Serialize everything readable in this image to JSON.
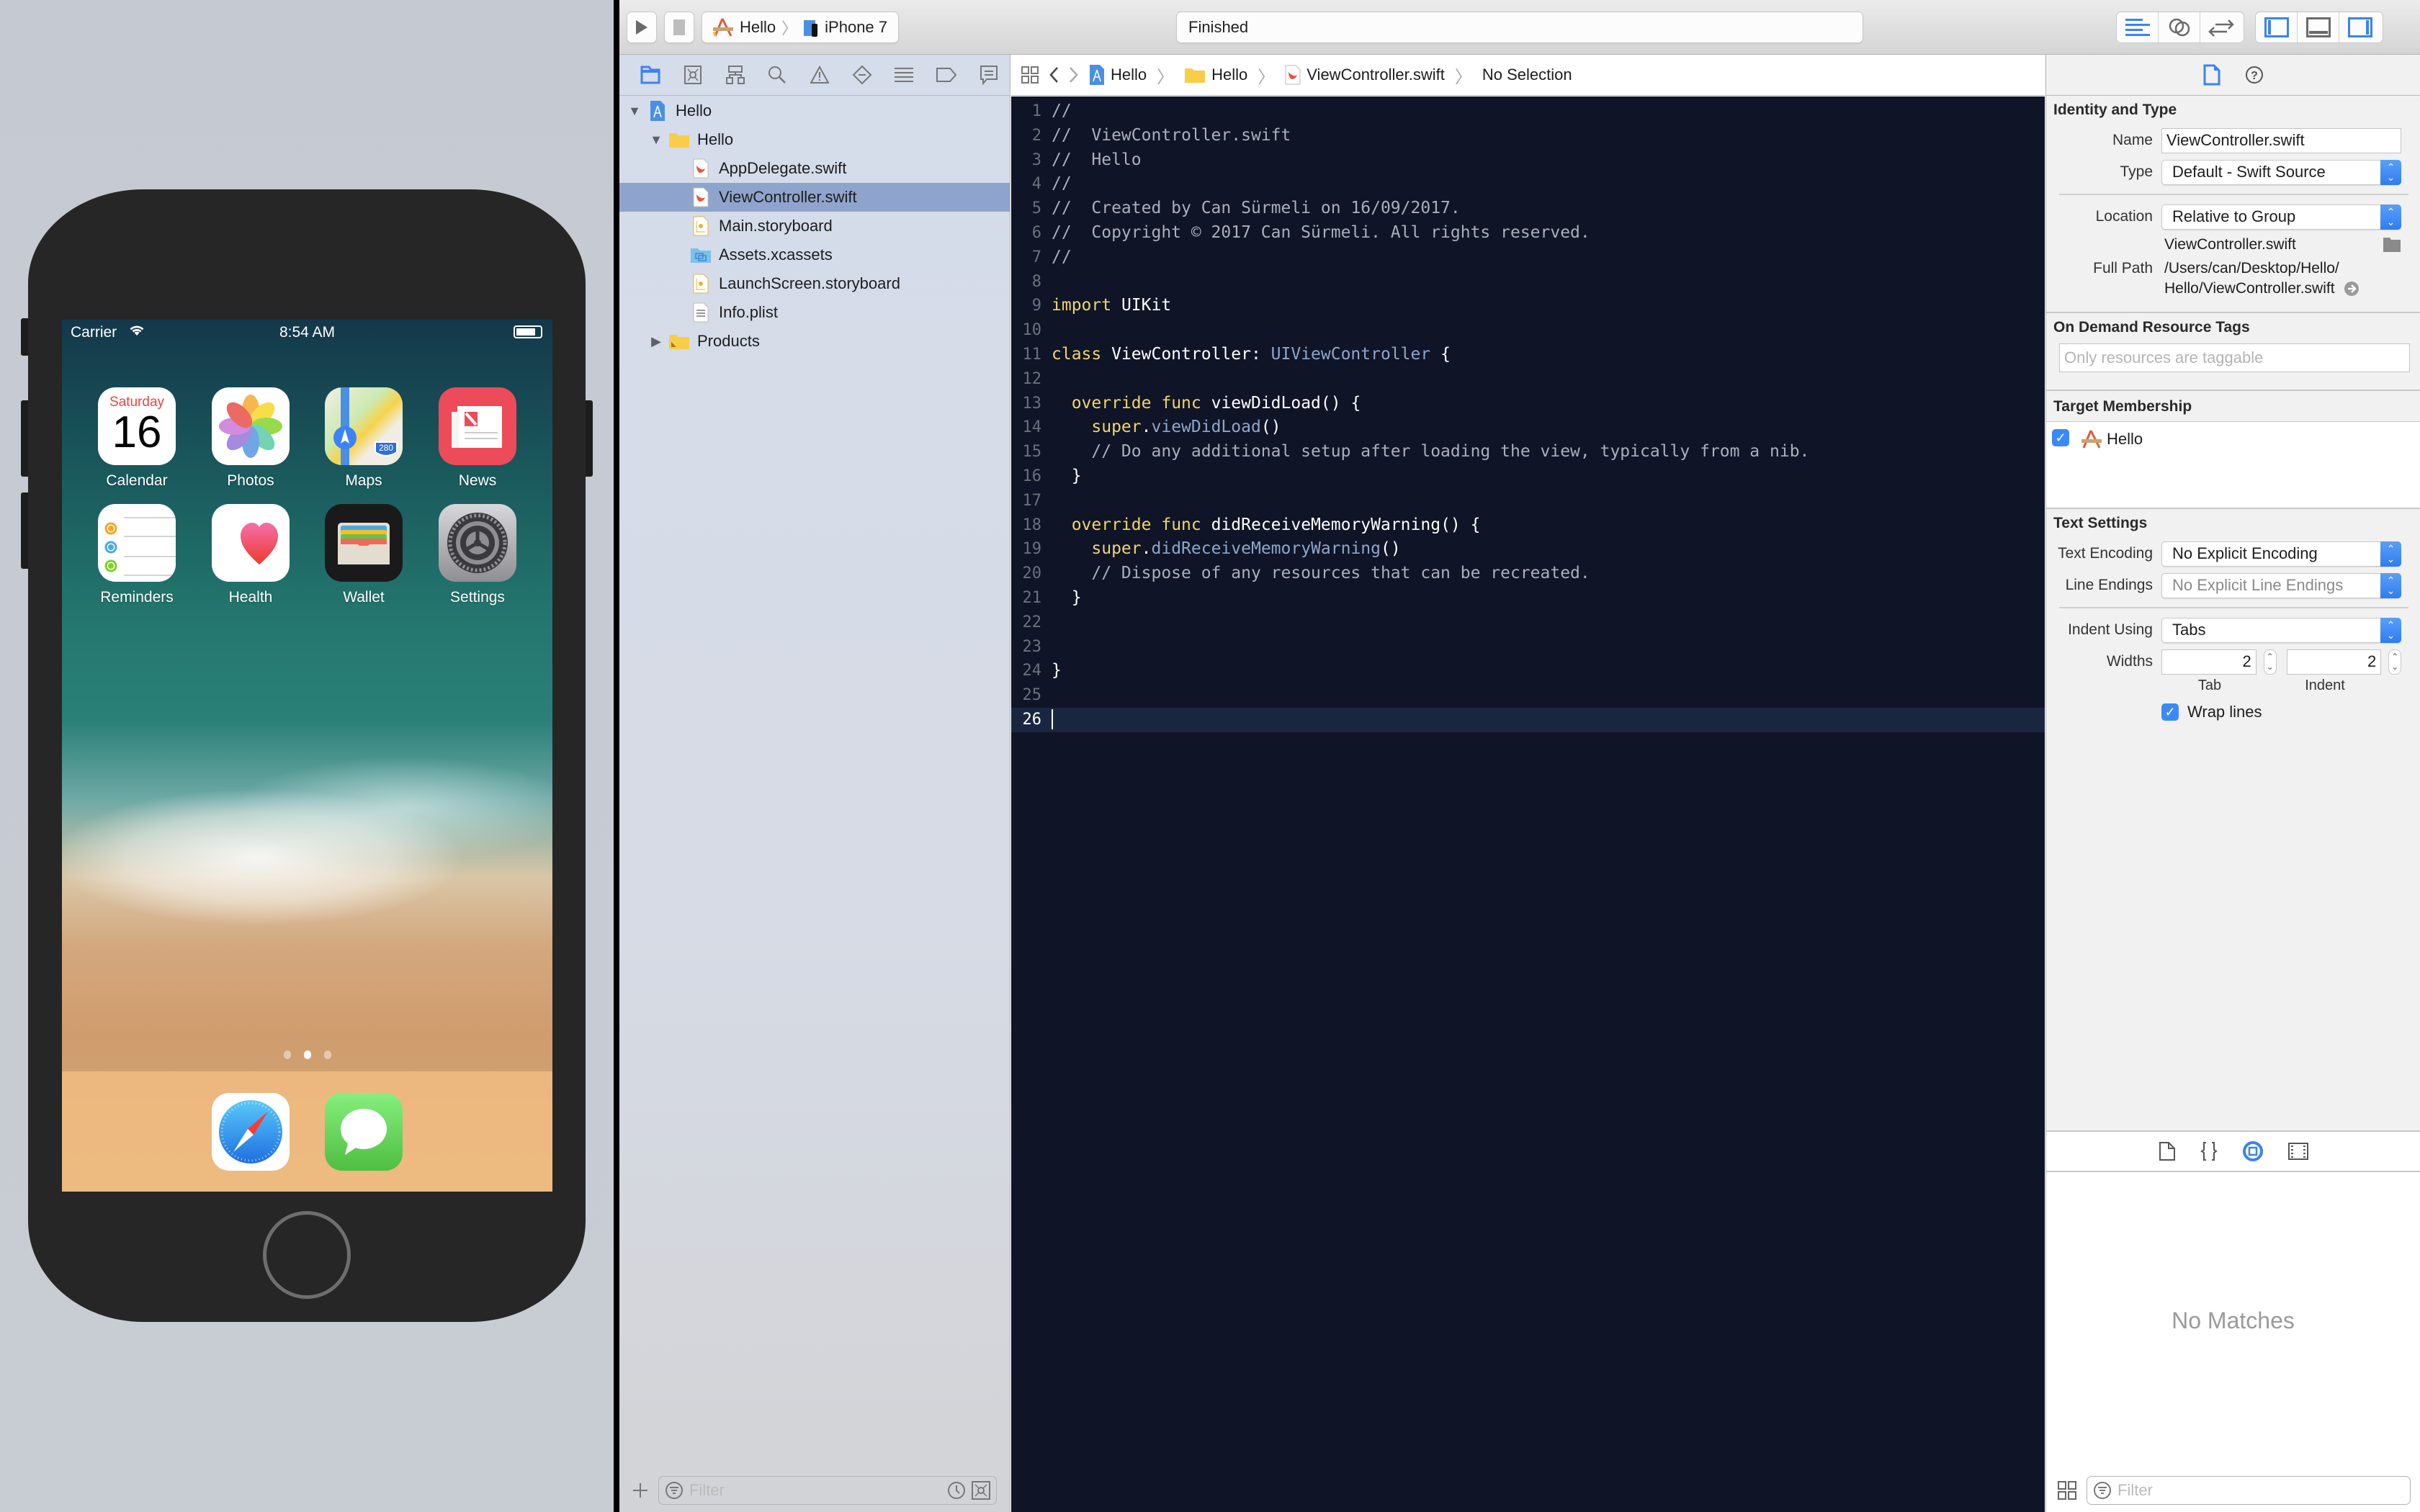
{
  "simulator": {
    "status_bar": {
      "carrier": "Carrier",
      "wifi_icon": "wifi-icon",
      "time": "8:54 AM",
      "battery_icon": "battery-icon"
    },
    "apps": [
      {
        "label": "Calendar",
        "icon": "calendar-icon",
        "calendar_day": "Saturday",
        "calendar_date": "16"
      },
      {
        "label": "Photos",
        "icon": "photos-icon"
      },
      {
        "label": "Maps",
        "icon": "maps-icon",
        "badge": "280"
      },
      {
        "label": "News",
        "icon": "news-icon"
      },
      {
        "label": "Reminders",
        "icon": "reminders-icon"
      },
      {
        "label": "Health",
        "icon": "health-icon"
      },
      {
        "label": "Wallet",
        "icon": "wallet-icon"
      },
      {
        "label": "Settings",
        "icon": "settings-icon"
      }
    ],
    "page_dots": {
      "count": 3,
      "active": 2
    },
    "dock": [
      {
        "icon": "safari-icon"
      },
      {
        "icon": "messages-icon"
      }
    ]
  },
  "toolbar": {
    "run_icon": "play-icon",
    "stop_icon": "stop-icon",
    "scheme": {
      "project": "Hello",
      "device": "iPhone 7"
    },
    "activity_status": "Finished",
    "editor_modes": [
      "standard-editor-icon",
      "assistant-editor-icon",
      "version-editor-icon"
    ],
    "panel_toggles": [
      "navigator-toggle-icon",
      "debug-area-toggle-icon",
      "utilities-toggle-icon"
    ],
    "accent": "#3b82f6"
  },
  "navigator": {
    "tabs": [
      "project-navigator-icon",
      "source-control-icon",
      "symbol-navigator-icon",
      "find-navigator-icon",
      "issue-navigator-icon",
      "test-navigator-icon",
      "debug-navigator-icon",
      "breakpoint-navigator-icon",
      "report-navigator-icon"
    ],
    "tree": [
      {
        "label": "Hello",
        "type": "project",
        "level": 0,
        "expanded": true
      },
      {
        "label": "Hello",
        "type": "folder",
        "level": 1,
        "expanded": true
      },
      {
        "label": "AppDelegate.swift",
        "type": "swift",
        "level": 2
      },
      {
        "label": "ViewController.swift",
        "type": "swift",
        "level": 2,
        "selected": true
      },
      {
        "label": "Main.storyboard",
        "type": "storyboard",
        "level": 2
      },
      {
        "label": "Assets.xcassets",
        "type": "assets",
        "level": 2
      },
      {
        "label": "LaunchScreen.storyboard",
        "type": "storyboard",
        "level": 2
      },
      {
        "label": "Info.plist",
        "type": "plist",
        "level": 2
      },
      {
        "label": "Products",
        "type": "products-folder",
        "level": 1,
        "expanded": false
      }
    ],
    "filter_placeholder": "Filter"
  },
  "jumpbar": {
    "crumbs": [
      "Hello",
      "Hello",
      "ViewController.swift",
      "No Selection"
    ]
  },
  "editor": {
    "current_line": 26,
    "lines": [
      [
        [
          "comment",
          "//"
        ]
      ],
      [
        [
          "comment",
          "//  ViewController.swift"
        ]
      ],
      [
        [
          "comment",
          "//  Hello"
        ]
      ],
      [
        [
          "comment",
          "//"
        ]
      ],
      [
        [
          "comment",
          "//  Created by Can Sürmeli on 16/09/2017."
        ]
      ],
      [
        [
          "comment",
          "//  Copyright © 2017 Can Sürmeli. All rights reserved."
        ]
      ],
      [
        [
          "comment",
          "//"
        ]
      ],
      [],
      [
        [
          "keyword",
          "import"
        ],
        [
          "plain",
          " UIKit"
        ]
      ],
      [],
      [
        [
          "keyword",
          "class"
        ],
        [
          "plain",
          " ViewController: "
        ],
        [
          "type",
          "UIViewController"
        ],
        [
          "plain",
          " {"
        ]
      ],
      [],
      [
        [
          "plain",
          "  "
        ],
        [
          "keyword",
          "override"
        ],
        [
          "plain",
          " "
        ],
        [
          "keyword",
          "func"
        ],
        [
          "plain",
          " viewDidLoad() {"
        ]
      ],
      [
        [
          "plain",
          "    "
        ],
        [
          "keyword",
          "super"
        ],
        [
          "plain",
          "."
        ],
        [
          "type",
          "viewDidLoad"
        ],
        [
          "plain",
          "()"
        ]
      ],
      [
        [
          "plain",
          "    "
        ],
        [
          "comment",
          "// Do any additional setup after loading the view, typically from a nib."
        ]
      ],
      [
        [
          "plain",
          "  }"
        ]
      ],
      [],
      [
        [
          "plain",
          "  "
        ],
        [
          "keyword",
          "override"
        ],
        [
          "plain",
          " "
        ],
        [
          "keyword",
          "func"
        ],
        [
          "plain",
          " didReceiveMemoryWarning() {"
        ]
      ],
      [
        [
          "plain",
          "    "
        ],
        [
          "keyword",
          "super"
        ],
        [
          "plain",
          "."
        ],
        [
          "type",
          "didReceiveMemoryWarning"
        ],
        [
          "plain",
          "()"
        ]
      ],
      [
        [
          "plain",
          "    "
        ],
        [
          "comment",
          "// Dispose of any resources that can be recreated."
        ]
      ],
      [
        [
          "plain",
          "  }"
        ]
      ],
      [],
      [],
      [
        [
          "plain",
          "}"
        ]
      ],
      [],
      []
    ]
  },
  "inspector": {
    "tabs": [
      "file-inspector-icon",
      "quick-help-icon"
    ],
    "identity": {
      "title": "Identity and Type",
      "name_label": "Name",
      "name_value": "ViewController.swift",
      "type_label": "Type",
      "type_value": "Default - Swift Source",
      "location_label": "Location",
      "location_value": "Relative to Group",
      "location_file": "ViewController.swift",
      "full_path_label": "Full Path",
      "full_path_line1": "/Users/can/Desktop/Hello/",
      "full_path_line2": "Hello/ViewController.swift"
    },
    "odr": {
      "title": "On Demand Resource Tags",
      "placeholder": "Only resources are taggable"
    },
    "target": {
      "title": "Target Membership",
      "items": [
        {
          "label": "Hello",
          "checked": true
        }
      ]
    },
    "text_settings": {
      "title": "Text Settings",
      "encoding_label": "Text Encoding",
      "encoding_value": "No Explicit Encoding",
      "line_endings_label": "Line Endings",
      "line_endings_value": "No Explicit Line Endings",
      "indent_using_label": "Indent Using",
      "indent_using_value": "Tabs",
      "widths_label": "Widths",
      "tab_width": "2",
      "indent_width": "2",
      "tab_caption": "Tab",
      "indent_caption": "Indent",
      "wrap_lines_label": "Wrap lines",
      "wrap_lines": true
    },
    "library_tabs": [
      "file-template-library-icon",
      "code-snippet-library-icon",
      "object-library-icon",
      "media-library-icon"
    ],
    "library_active": 2,
    "library_empty": "No Matches",
    "filter_placeholder": "Filter"
  }
}
